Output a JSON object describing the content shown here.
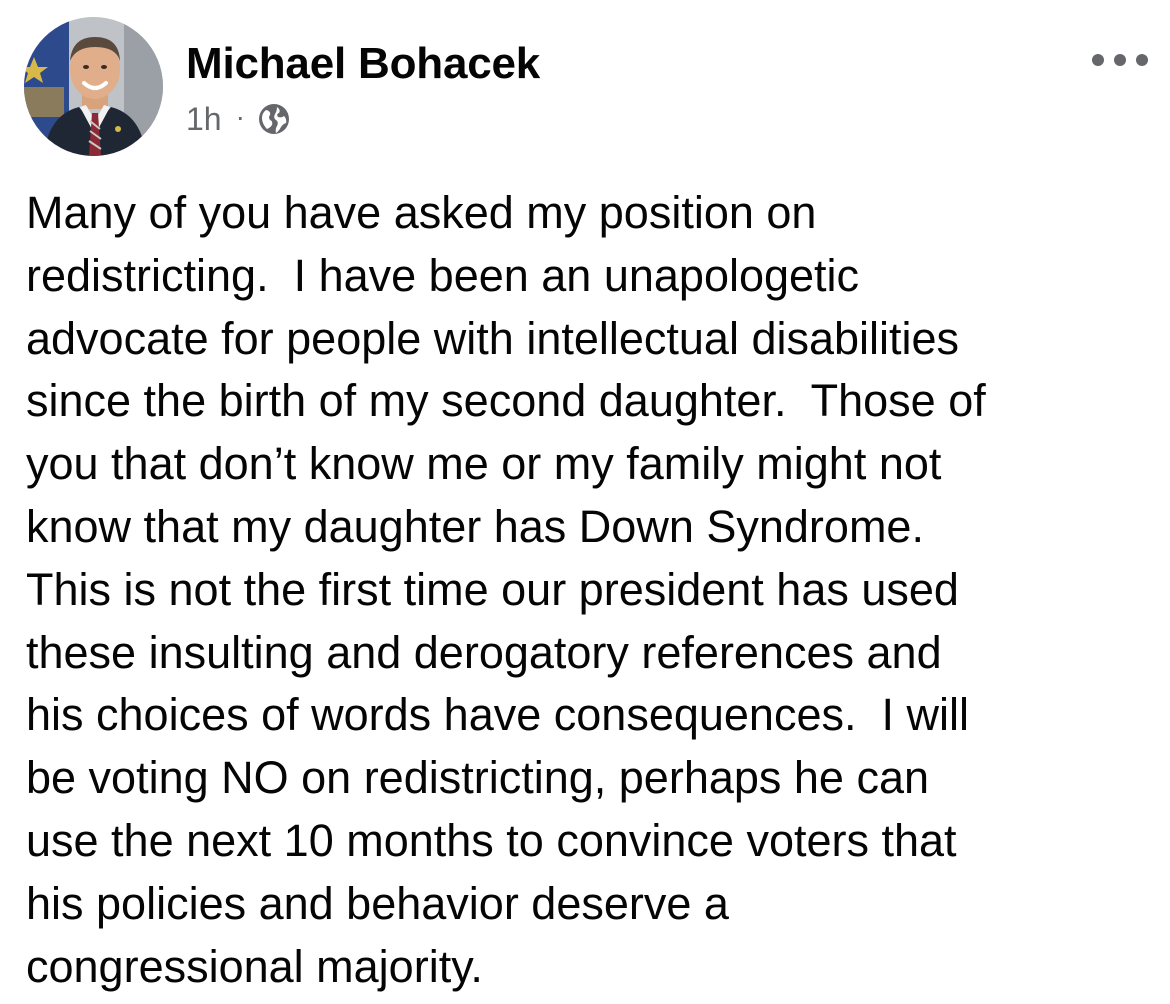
{
  "author": {
    "name": "Michael Bohacek",
    "avatar_icon": "profile-photo"
  },
  "meta": {
    "timestamp": "1h",
    "separator": "·",
    "audience_icon": "globe-icon"
  },
  "menu": {
    "more_icon": "more-horizontal-icon"
  },
  "post": {
    "lines": [
      "Many of you have asked my position on",
      "redistricting.  I have been an unapologetic",
      "advocate for people with intellectual disabilities",
      "since the birth of my second daughter.  Those of",
      "you that don’t know me or my family might not",
      "know that my daughter has Down Syndrome.",
      "This is not the first time our president has used",
      "these insulting and derogatory references and",
      "his choices of words have consequences.  I will",
      "be voting NO on redistricting, perhaps he can",
      "use the next 10 months to convince voters that",
      "his policies and behavior deserve a",
      "congressional majority."
    ]
  },
  "colors": {
    "text_primary": "#050505",
    "text_secondary": "#65676b",
    "background": "#ffffff"
  }
}
